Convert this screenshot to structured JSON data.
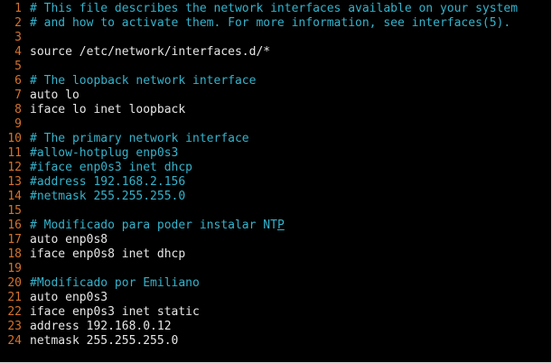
{
  "editor": {
    "lines": [
      {
        "n": "1",
        "text": "# This file describes the network interfaces available on your system",
        "type": "comment"
      },
      {
        "n": "2",
        "text": "# and how to activate them. For more information, see interfaces(5).",
        "type": "comment"
      },
      {
        "n": "3",
        "text": "",
        "type": "code"
      },
      {
        "n": "4",
        "text": "source /etc/network/interfaces.d/*",
        "type": "code"
      },
      {
        "n": "5",
        "text": "",
        "type": "code"
      },
      {
        "n": "6",
        "text": "# The loopback network interface",
        "type": "comment"
      },
      {
        "n": "7",
        "text": "auto lo",
        "type": "code"
      },
      {
        "n": "8",
        "text": "iface lo inet loopback",
        "type": "code"
      },
      {
        "n": "9",
        "text": "",
        "type": "code"
      },
      {
        "n": "10",
        "text": "# The primary network interface",
        "type": "comment"
      },
      {
        "n": "11",
        "text": "#allow-hotplug enp0s3",
        "type": "comment"
      },
      {
        "n": "12",
        "text": "#iface enp0s3 inet dhcp",
        "type": "comment"
      },
      {
        "n": "13",
        "text": "#address 192.168.2.156",
        "type": "comment"
      },
      {
        "n": "14",
        "text": "#netmask 255.255.255.0",
        "type": "comment"
      },
      {
        "n": "15",
        "text": "",
        "type": "code"
      },
      {
        "n": "16",
        "text": "# Modificado para poder instalar NT",
        "cursor": "P",
        "type": "comment"
      },
      {
        "n": "17",
        "text": "auto enp0s8",
        "type": "code"
      },
      {
        "n": "18",
        "text": "iface enp0s8 inet dhcp",
        "type": "code"
      },
      {
        "n": "19",
        "text": "",
        "type": "code"
      },
      {
        "n": "20",
        "text": "#Modificado por Emiliano",
        "type": "comment"
      },
      {
        "n": "21",
        "text": "auto enp0s3",
        "type": "code"
      },
      {
        "n": "22",
        "text": "iface enp0s3 inet static",
        "type": "code"
      },
      {
        "n": "23",
        "text": "address 192.168.0.12",
        "type": "code"
      },
      {
        "n": "24",
        "text": "netmask 255.255.255.0",
        "type": "code"
      }
    ]
  },
  "colors": {
    "background": "#000000",
    "line_number": "#d4722c",
    "comment": "#34b3cc",
    "text": "#e6e6e6"
  }
}
